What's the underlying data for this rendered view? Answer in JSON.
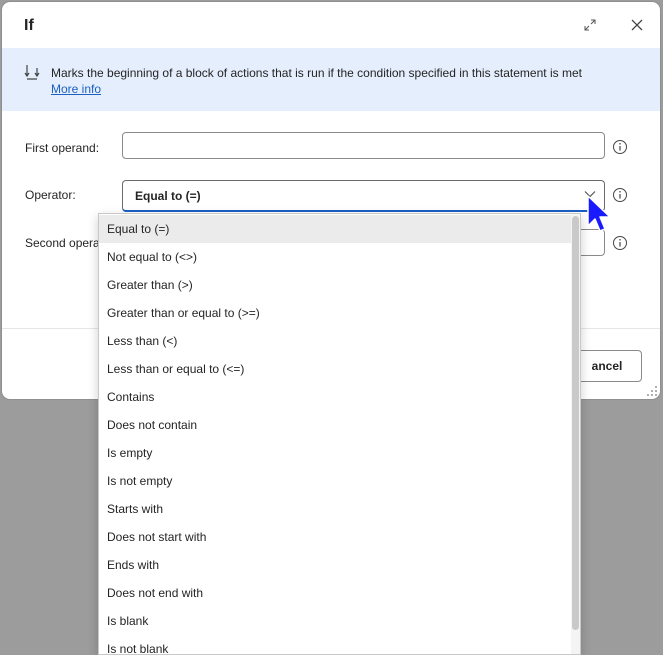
{
  "dialog": {
    "title": "If",
    "banner": {
      "text": "Marks the beginning of a block of actions that is run if the condition specified in this statement is met",
      "link": "More info"
    },
    "fields": {
      "first_operand_label": "First operand:",
      "first_operand_value": "",
      "operator_label": "Operator:",
      "operator_value": "Equal to (=)",
      "second_operand_label": "Second opera"
    },
    "cancel_label": "ancel"
  },
  "dropdown": {
    "selected_index": 0,
    "options": [
      "Equal to (=)",
      "Not equal to (<>)",
      "Greater than (>)",
      "Greater than or equal to (>=)",
      "Less than (<)",
      "Less than or equal to (<=)",
      "Contains",
      "Does not contain",
      "Is empty",
      "Is not empty",
      "Starts with",
      "Does not start with",
      "Ends with",
      "Does not end with",
      "Is blank",
      "Is not blank"
    ]
  },
  "icons": {
    "expand": "expand-icon",
    "close": "close-icon",
    "banner": "flow-down-icon",
    "info": "info-icon",
    "chevron": "chevron-down-icon",
    "cursor": "mouse-pointer-icon"
  },
  "colors": {
    "accent": "#1c5fc2",
    "banner_bg": "#e5eefc",
    "selected_option_bg": "#ebebeb",
    "overlay": "#9c9c9c",
    "cursor": "#1a1aff"
  }
}
